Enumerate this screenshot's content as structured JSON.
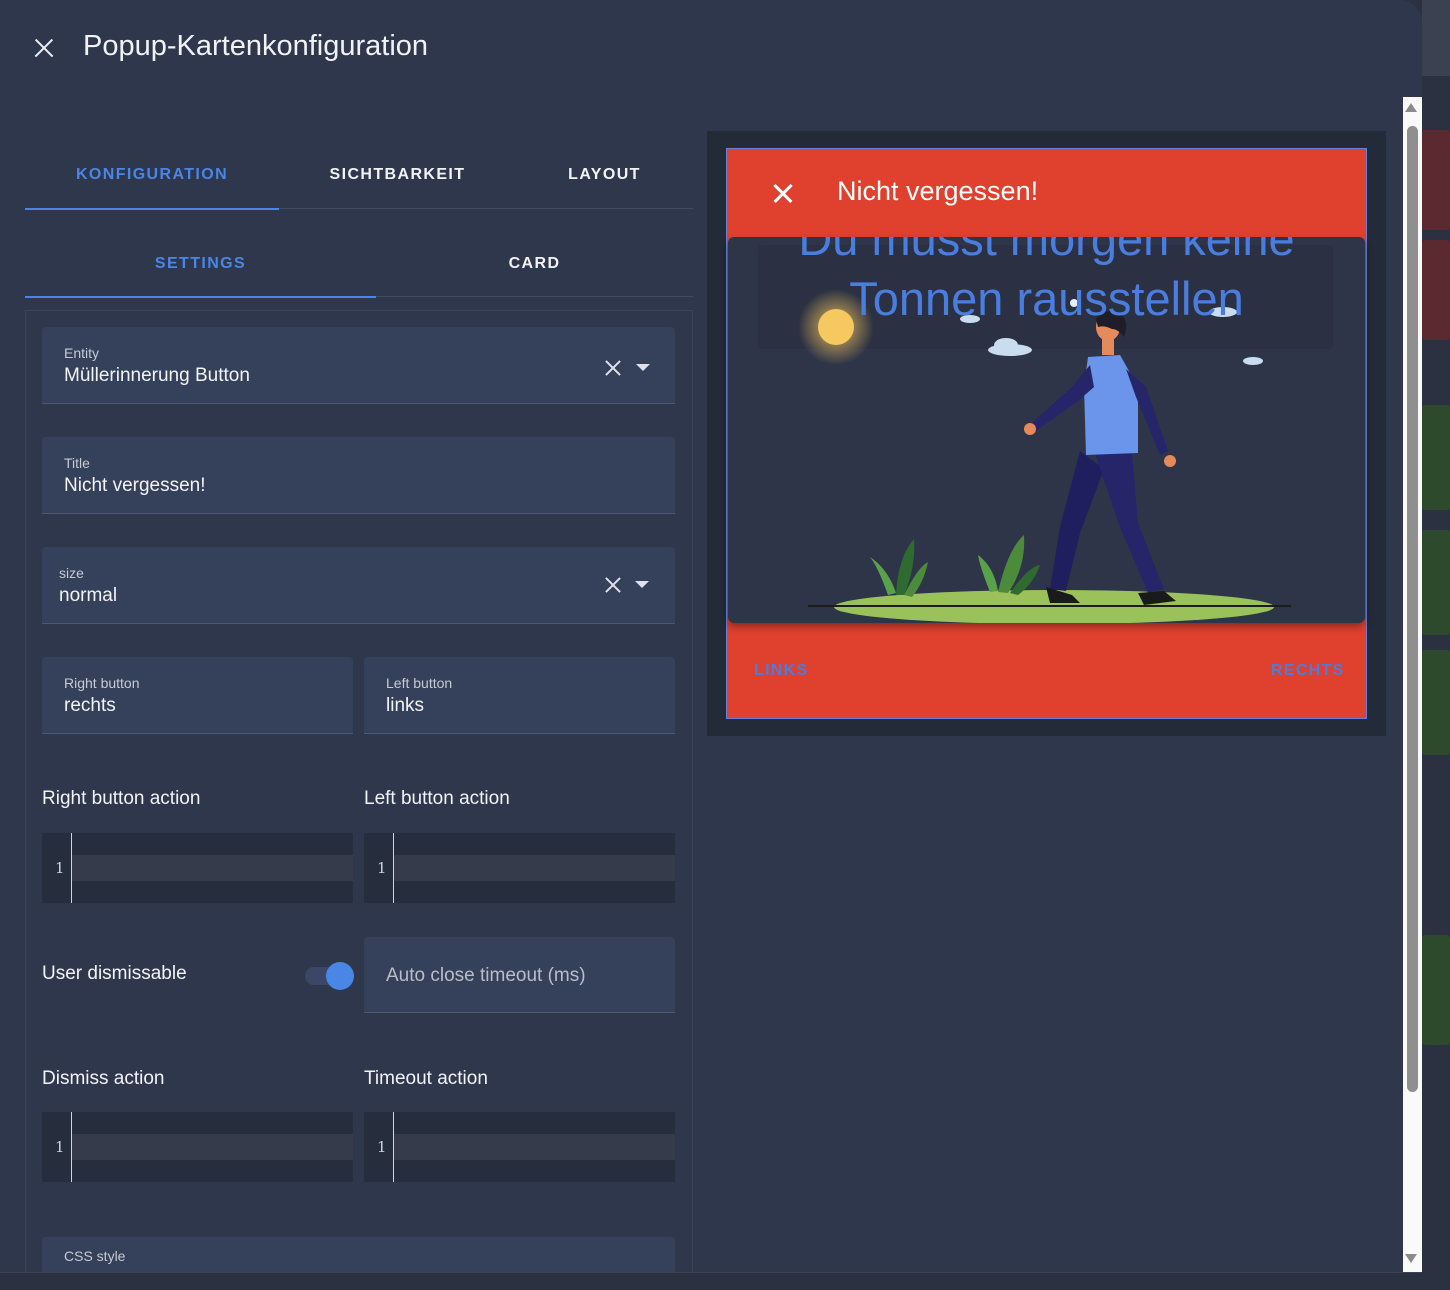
{
  "dialog": {
    "title": "Popup-Kartenkonfiguration"
  },
  "tabs": [
    {
      "label": "KONFIGURATION",
      "active": true
    },
    {
      "label": "SICHTBARKEIT",
      "active": false
    },
    {
      "label": "LAYOUT",
      "active": false
    }
  ],
  "subtabs": [
    {
      "label": "SETTINGS",
      "active": true
    },
    {
      "label": "CARD",
      "active": false
    }
  ],
  "form": {
    "entity": {
      "label": "Entity",
      "value": "Müllerinnerung Button"
    },
    "title": {
      "label": "Title",
      "value": "Nicht vergessen!"
    },
    "size": {
      "label": "size",
      "value": "normal"
    },
    "right_button": {
      "label": "Right button",
      "value": "rechts"
    },
    "left_button": {
      "label": "Left button",
      "value": "links"
    },
    "right_button_action": {
      "label": "Right button action",
      "line": "1"
    },
    "left_button_action": {
      "label": "Left button action",
      "line": "1"
    },
    "user_dismissable": {
      "label": "User dismissable",
      "on": true
    },
    "auto_close": {
      "placeholder": "Auto close timeout (ms)"
    },
    "dismiss_action": {
      "label": "Dismiss action",
      "line": "1"
    },
    "timeout_action": {
      "label": "Timeout action",
      "line": "1"
    },
    "css_style": {
      "label": "CSS style"
    }
  },
  "preview": {
    "popup_title": "Nicht vergessen!",
    "message": "Du musst morgen keine Tonnen rausstellen",
    "left_button": "LINKS",
    "right_button": "RECHTS",
    "colors": {
      "popup_bg": "#e0412e",
      "accent": "#4a86e6"
    }
  }
}
